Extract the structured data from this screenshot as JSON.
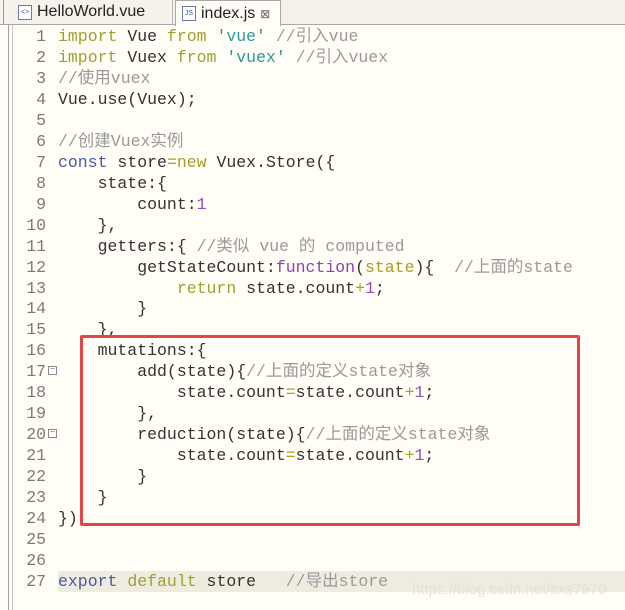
{
  "tabs": [
    {
      "label": "HelloWorld.vue",
      "icon": "vue-file-icon",
      "active": false
    },
    {
      "label": "index.js",
      "icon": "js-file-icon",
      "active": true,
      "close": "⊠"
    }
  ],
  "fold_marker": "−",
  "watermark": "https://blog.csdn.net/sxs7970",
  "highlight_color": "#e04848",
  "lines": [
    {
      "n": "1",
      "t": [
        [
          "import",
          "k"
        ],
        [
          " Vue ",
          ""
        ],
        [
          "from",
          "k"
        ],
        [
          " ",
          ""
        ],
        [
          "'vue'",
          "s"
        ],
        [
          " //引入vue",
          "c"
        ]
      ]
    },
    {
      "n": "2",
      "t": [
        [
          "import",
          "k"
        ],
        [
          " Vuex ",
          ""
        ],
        [
          "from",
          "k"
        ],
        [
          " ",
          ""
        ],
        [
          "'vuex'",
          "s"
        ],
        [
          " //引入vuex",
          "c"
        ]
      ]
    },
    {
      "n": "3",
      "t": [
        [
          "//使用vuex",
          "c"
        ]
      ]
    },
    {
      "n": "4",
      "t": [
        [
          "Vue.use(Vuex);",
          ""
        ]
      ]
    },
    {
      "n": "5",
      "t": []
    },
    {
      "n": "6",
      "t": [
        [
          "//创建Vuex实例",
          "c"
        ]
      ]
    },
    {
      "n": "7",
      "t": [
        [
          "const",
          "b"
        ],
        [
          " store",
          ""
        ],
        [
          "=",
          "o"
        ],
        [
          "new",
          "k"
        ],
        [
          " Vuex.Store({",
          ""
        ]
      ]
    },
    {
      "n": "8",
      "t": [
        [
          "    state:{",
          ""
        ]
      ]
    },
    {
      "n": "9",
      "t": [
        [
          "        count:",
          ""
        ],
        [
          "1",
          "n"
        ]
      ]
    },
    {
      "n": "10",
      "t": [
        [
          "    },",
          ""
        ]
      ]
    },
    {
      "n": "11",
      "t": [
        [
          "    getters:{ ",
          ""
        ],
        [
          "//类似 vue 的 computed",
          "c"
        ]
      ]
    },
    {
      "n": "12",
      "t": [
        [
          "        getStateCount:",
          ""
        ],
        [
          "function",
          "f"
        ],
        [
          "(",
          ""
        ],
        [
          "state",
          "p"
        ],
        [
          "){  ",
          ""
        ],
        [
          "//上面的state",
          "c"
        ]
      ]
    },
    {
      "n": "13",
      "t": [
        [
          "            ",
          ""
        ],
        [
          "return",
          "k"
        ],
        [
          " state.count",
          ""
        ],
        [
          "+",
          "o"
        ],
        [
          "1",
          "n"
        ],
        [
          ";",
          ""
        ]
      ]
    },
    {
      "n": "14",
      "t": [
        [
          "        }",
          ""
        ]
      ]
    },
    {
      "n": "15",
      "t": [
        [
          "    },",
          ""
        ]
      ]
    },
    {
      "n": "16",
      "t": [
        [
          "    mutations:{",
          ""
        ]
      ]
    },
    {
      "n": "17",
      "fold": true,
      "t": [
        [
          "        add(state){",
          ""
        ],
        [
          "//上面的定义state对象",
          "c"
        ]
      ]
    },
    {
      "n": "18",
      "t": [
        [
          "            state.count",
          ""
        ],
        [
          "=",
          "o"
        ],
        [
          "state.count",
          ""
        ],
        [
          "+",
          "o"
        ],
        [
          "1",
          "n"
        ],
        [
          ";",
          ""
        ]
      ]
    },
    {
      "n": "19",
      "t": [
        [
          "        },",
          ""
        ]
      ]
    },
    {
      "n": "20",
      "fold": true,
      "t": [
        [
          "        reduction(state){",
          ""
        ],
        [
          "//上面的定义state对象",
          "c"
        ]
      ]
    },
    {
      "n": "21",
      "t": [
        [
          "            state.count",
          ""
        ],
        [
          "=",
          "o"
        ],
        [
          "state.count",
          ""
        ],
        [
          "+",
          "o"
        ],
        [
          "1",
          "n"
        ],
        [
          ";",
          ""
        ]
      ]
    },
    {
      "n": "22",
      "t": [
        [
          "        }",
          ""
        ]
      ]
    },
    {
      "n": "23",
      "t": [
        [
          "    }",
          ""
        ]
      ]
    },
    {
      "n": "24",
      "t": [
        [
          "})",
          ""
        ]
      ]
    },
    {
      "n": "25",
      "t": []
    },
    {
      "n": "26",
      "t": []
    },
    {
      "n": "27",
      "current": true,
      "t": [
        [
          "export",
          "b"
        ],
        [
          " ",
          ""
        ],
        [
          "default",
          "k"
        ],
        [
          " store   ",
          ""
        ],
        [
          "//导出store",
          "c"
        ]
      ]
    }
  ]
}
